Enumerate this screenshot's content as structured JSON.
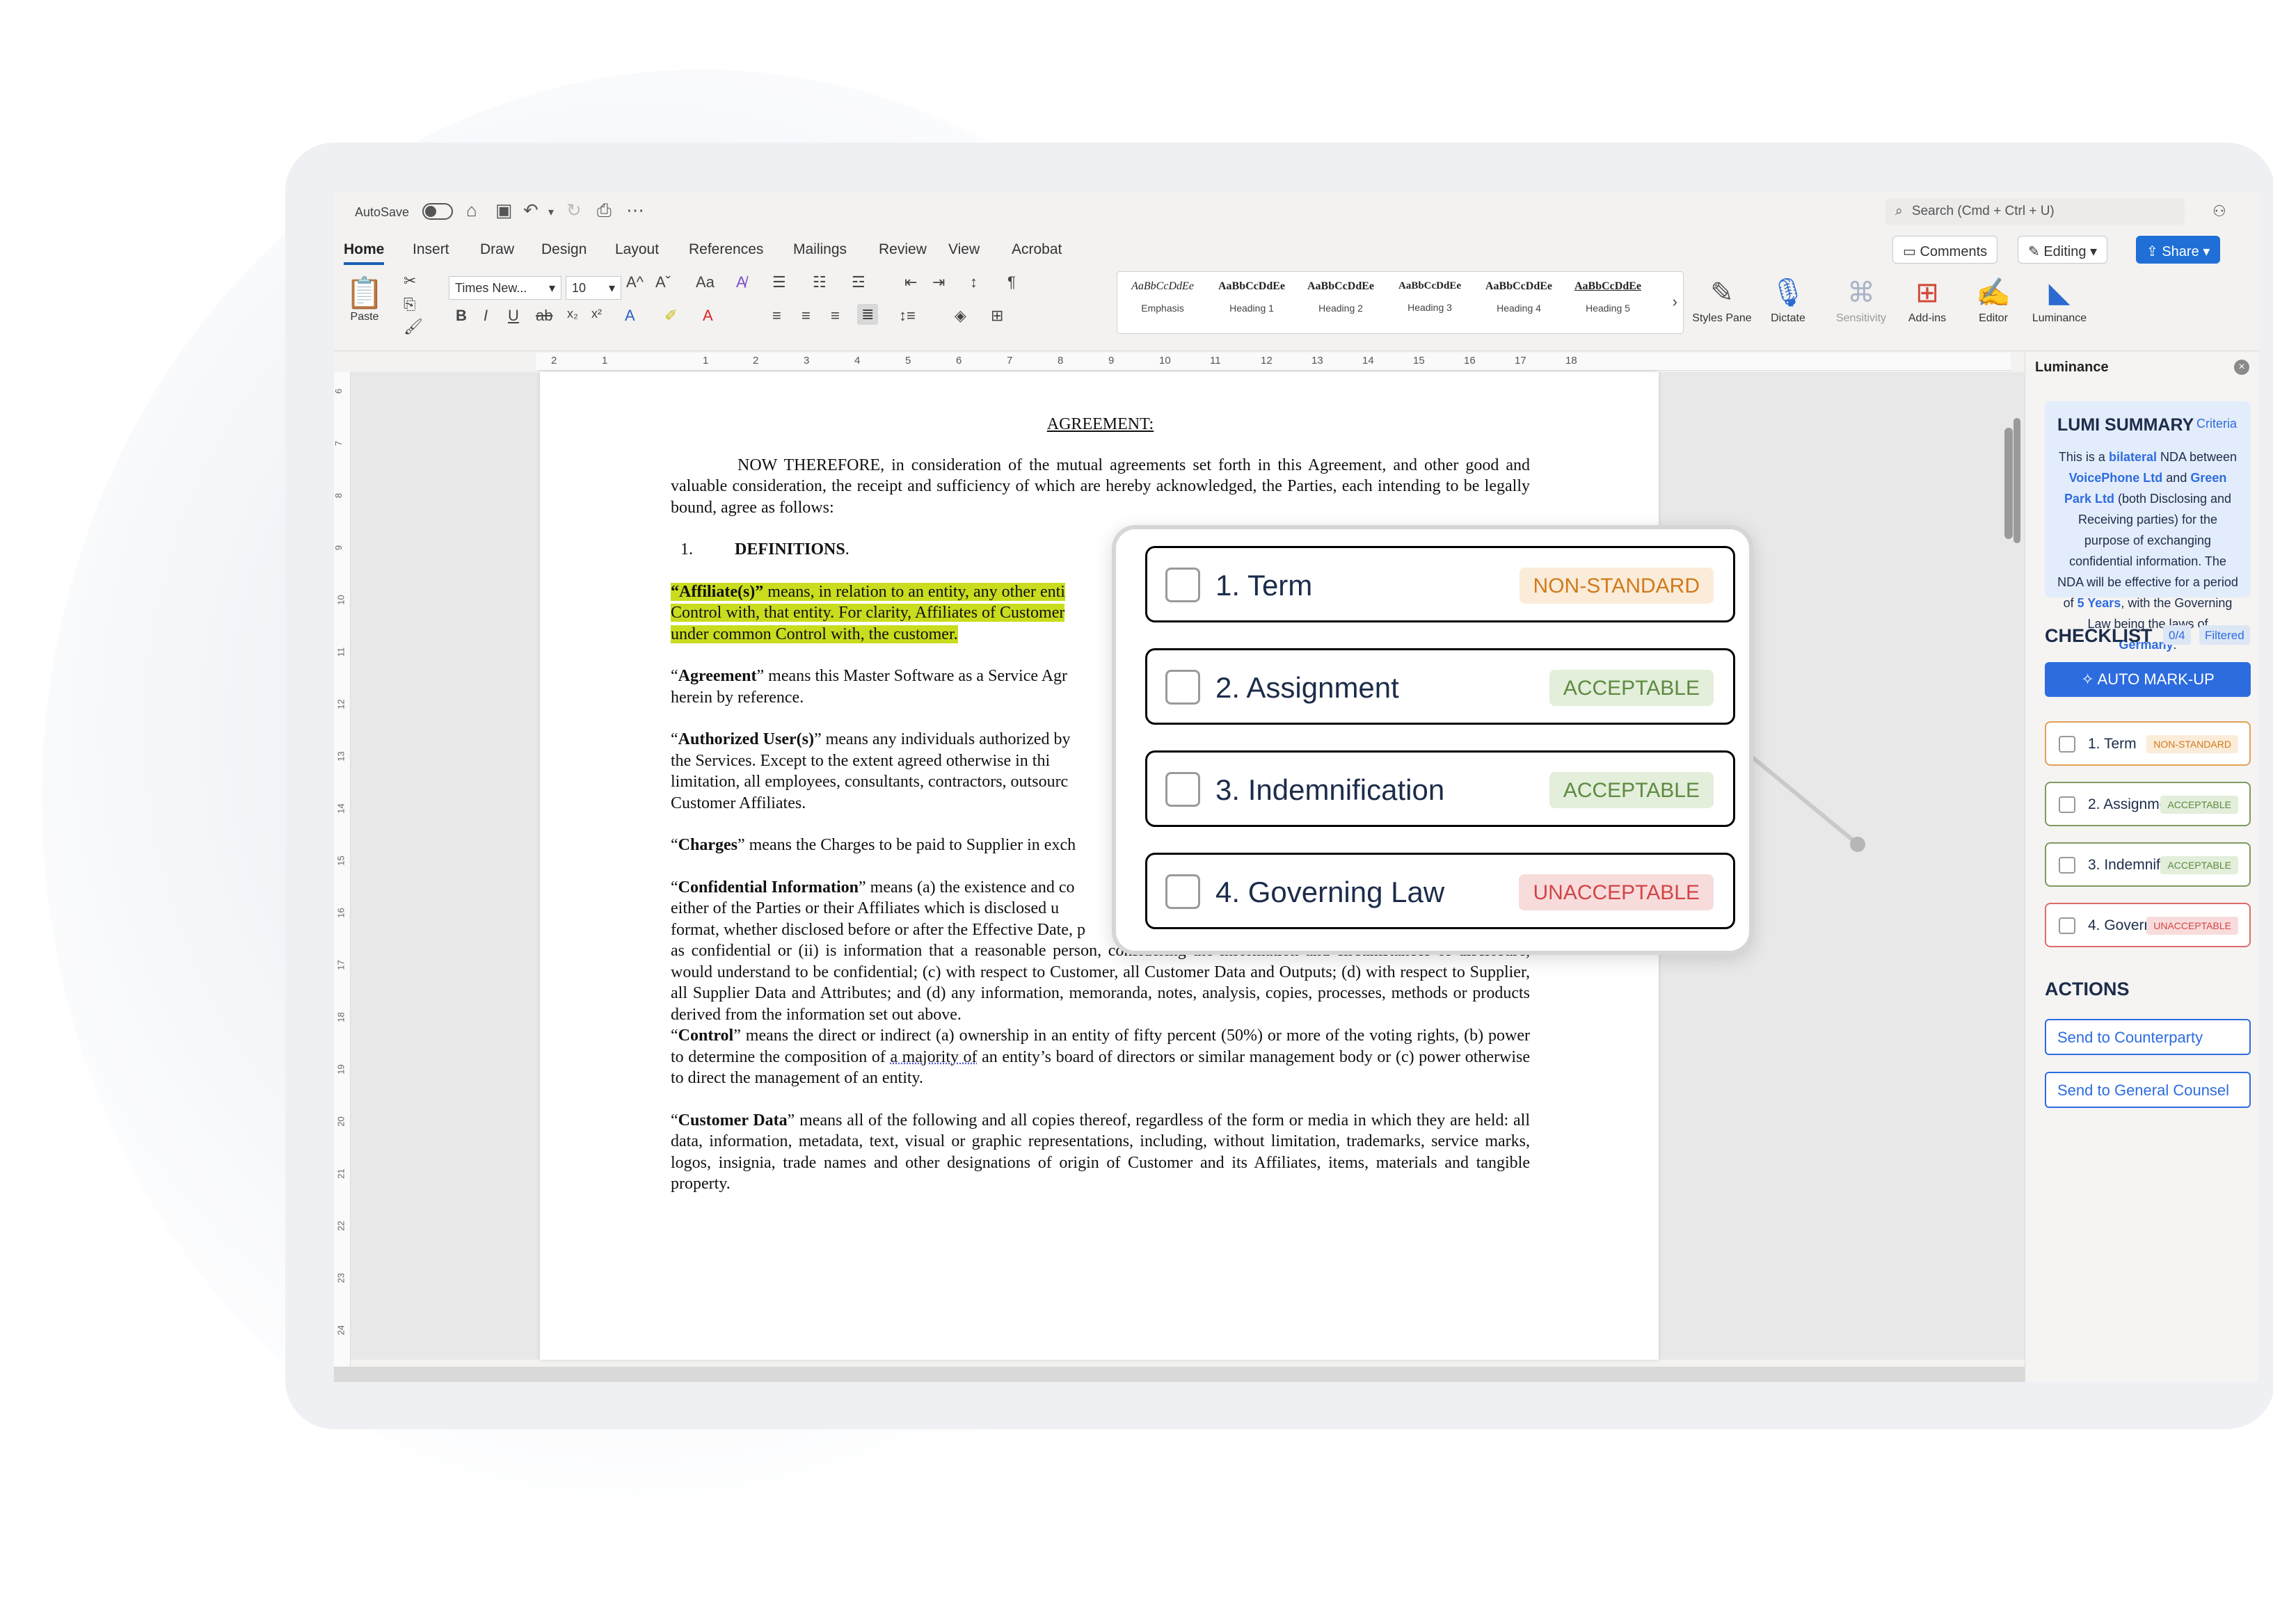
{
  "titlebar": {
    "autosave_label": "AutoSave",
    "search_placeholder": "Search (Cmd + Ctrl + U)"
  },
  "tabs": [
    "Home",
    "Insert",
    "Draw",
    "Design",
    "Layout",
    "References",
    "Mailings",
    "Review",
    "View",
    "Acrobat"
  ],
  "header_buttons": {
    "comments": "Comments",
    "editing": "Editing",
    "share": "Share"
  },
  "font": {
    "family": "Times New...",
    "size": "10"
  },
  "paste_label": "Paste",
  "styles": [
    {
      "sample": "AaBbCcDdEe",
      "name": "Emphasis"
    },
    {
      "sample": "AaBbCcDdEe",
      "name": "Heading 1"
    },
    {
      "sample": "AaBbCcDdEe",
      "name": "Heading 2"
    },
    {
      "sample": "AaBbCcDdEe",
      "name": "Heading 3"
    },
    {
      "sample": "AaBbCcDdEe",
      "name": "Heading 4"
    },
    {
      "sample": "AaBbCcDdEe",
      "name": "Heading 5"
    }
  ],
  "big_buttons": {
    "styles_pane": "Styles Pane",
    "dictate": "Dictate",
    "sensitivity": "Sensitivity",
    "addins": "Add-ins",
    "editor": "Editor",
    "luminance": "Luminance"
  },
  "ruler_numbers": [
    "2",
    "1",
    "1",
    "2",
    "3",
    "4",
    "5",
    "6",
    "7",
    "8",
    "9",
    "10",
    "11",
    "12",
    "13",
    "14",
    "15",
    "16",
    "17",
    "18"
  ],
  "vruler_numbers": [
    "6",
    "7",
    "8",
    "9",
    "10",
    "11",
    "12",
    "13",
    "14",
    "15",
    "16",
    "17",
    "18",
    "19",
    "20",
    "21",
    "22",
    "23",
    "24"
  ],
  "document": {
    "title": "AGREEMENT:",
    "intro": "NOW THEREFORE, in consideration of the mutual agreements set forth in this Agreement, and other good and valuable consideration, the receipt and sufficiency of which are hereby acknowledged, the Parties, each intending to be legally bound, agree as follows:",
    "section_number": "1.",
    "section_title": "DEFINITIONS",
    "affiliate_term": "“Affiliate(s)”",
    "affiliate_text": " means, in relation to an entity, any other enti",
    "affiliate_line2": "Control with, that entity. For clarity, Affiliates of Customer",
    "affiliate_line3": "under common Control with, the customer.",
    "agreement_term": "Agreement",
    "agreement_text": "” means this Master Software as a Service Agr",
    "agreement_line2": "herein by reference.",
    "users_term": "Authorized User(s)",
    "users_text": "” means any individuals authorized by",
    "users_line2": "the Services. Except to the extent agreed otherwise in thi",
    "users_line3": "limitation, all employees, consultants, contractors, outsourc",
    "users_line4": "Customer Affiliates.",
    "charges_term": "Charges",
    "charges_text": "” means the Charges to be paid to Supplier in exch",
    "conf_term": "Confidential Information",
    "conf_text": "” means (a) the existence and co",
    "conf_line2": "either of the Parties or their Affiliates which is disclosed u",
    "conf_line3": "format, whether disclosed before or after the Effective Date, p",
    "conf_line4": "as confidential or (ii) is information that a reasonable person, considering the information and circumstances of disclosure, would understand to be confidential; (c) with respect to Customer, all Customer Data and Outputs; (d) with respect to Supplier, all Supplier Data and Attributes; and (d) any information, memoranda, notes, analysis, copies, processes, methods or products derived from the information set out above.",
    "control_term": "Control",
    "control_text1": "” means the direct or indirect (a) ownership in an entity of fifty percent (50%) or more of the voting rights, (b) power to determine the composition of",
    "control_wavy": "a majority of",
    "control_text2": " an entity’s board of directors or similar management body or (c) power otherwise to direct the management of an entity.",
    "cdata_term": "Customer Data",
    "cdata_text": "” means all of the following and all copies thereof, regardless of the form or media in which they are held: all data, information, metadata, text, visual or graphic representations, including, without limitation, trademarks, service marks, logos, insignia, trade names and other designations of origin of Customer and its Affiliates, items, materials and tangible property."
  },
  "panel": {
    "header": "Luminance",
    "summary_title": "LUMI SUMMARY",
    "criteria_link": "Criteria",
    "summary": {
      "p1": "This is a ",
      "bilateral": "bilateral",
      "p2": " NDA between ",
      "party1": "VoicePhone Ltd",
      "p3": " and ",
      "party2": "Green Park Ltd",
      "p4": " (both Disclosing and Receiving parties) for the purpose of exchanging confidential information. The NDA will be effective for a period of ",
      "period": "5 Years",
      "p5": ", with the Governing Law being the laws of ",
      "law": "Germany",
      "p6": "."
    },
    "checklist_title": "CHECKLIST",
    "checklist_count": "0/4",
    "filtered": "Filtered",
    "auto_markup": "AUTO MARK-UP",
    "items": [
      {
        "label": "1. Term",
        "tag": "NON-STANDARD"
      },
      {
        "label": "2. Assignment",
        "tag": "ACCEPTABLE"
      },
      {
        "label": "3. Indemnification",
        "tag": "ACCEPTABLE"
      },
      {
        "label": "4. Governing Law",
        "tag": "UNACCEPTABLE"
      }
    ],
    "actions_title": "ACTIONS",
    "actions": [
      "Send to Counterparty",
      "Send to General Counsel"
    ]
  },
  "colors": {
    "accent": "#2d6cdf",
    "non_standard": "#d07a1c",
    "acceptable": "#5d8a3f",
    "unacceptable": "#d24545",
    "highlight": "#c9dd1e"
  }
}
